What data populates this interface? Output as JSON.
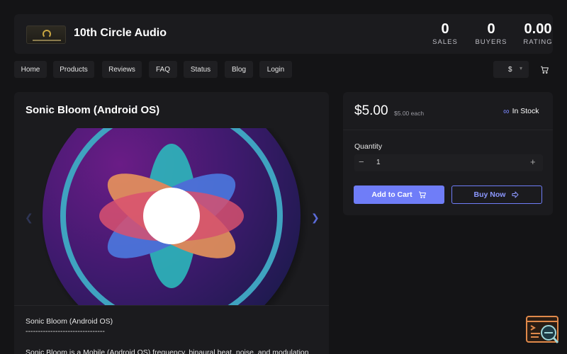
{
  "header": {
    "store_name": "10th Circle Audio",
    "stats": [
      {
        "value": "0",
        "label": "SALES"
      },
      {
        "value": "0",
        "label": "BUYERS"
      },
      {
        "value": "0.00",
        "label": "RATING"
      }
    ]
  },
  "nav": {
    "items": [
      "Home",
      "Products",
      "Reviews",
      "FAQ",
      "Status",
      "Blog",
      "Login"
    ],
    "currency": "$"
  },
  "product": {
    "title": "Sonic Bloom (Android OS)",
    "description_title": "Sonic Bloom (Android OS)",
    "description_divider": "--------------------------------",
    "description_body": "Sonic Bloom is a Mobile (Android OS) frequency, binaural beat, noise, and modulation"
  },
  "purchase": {
    "price": "$5.00",
    "price_each": "$5.00 each",
    "stock": "In Stock",
    "quantity_label": "Quantity",
    "quantity_value": "1",
    "add_to_cart": "Add to Cart",
    "buy_now": "Buy Now"
  },
  "icons": {
    "cart": "cart-icon",
    "infinity": "infinity-icon",
    "arrow_left": "chevron-left-icon",
    "arrow_right": "chevron-right-icon"
  },
  "colors": {
    "accent": "#6f7df8",
    "background": "#141416",
    "panel": "#1b1b1e"
  }
}
